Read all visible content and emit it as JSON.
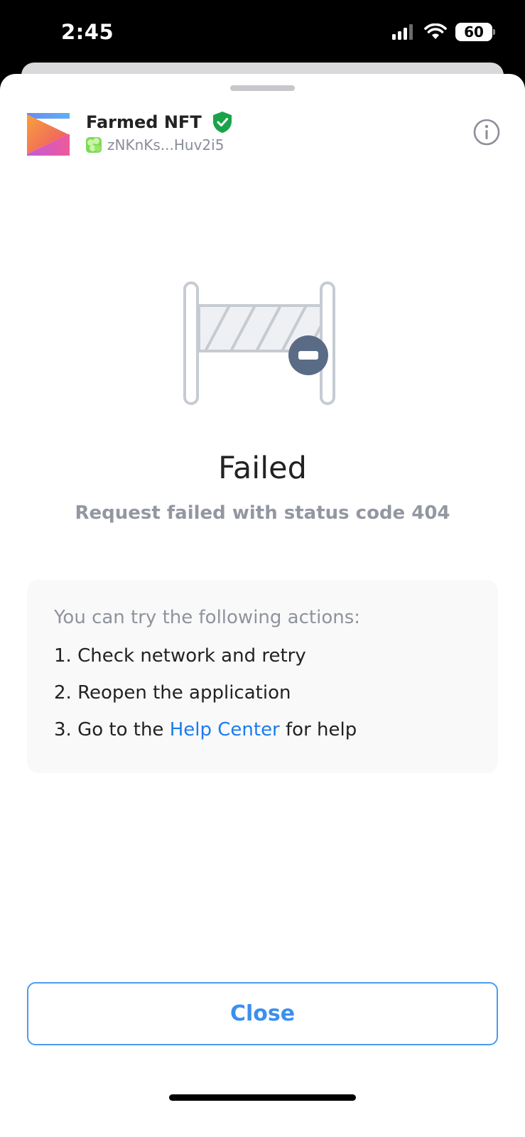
{
  "status_bar": {
    "time": "2:45",
    "battery": "60"
  },
  "dapp": {
    "name": "Farmed NFT",
    "address": "zNKnKs...Huv2i5"
  },
  "result": {
    "title": "Failed",
    "message": "Request failed with status code 404"
  },
  "suggestions": {
    "heading": "You can try the following actions:",
    "item1": "1. Check network and retry",
    "item2": "2. Reopen the application",
    "item3_prefix": "3. Go to the ",
    "item3_link": "Help Center",
    "item3_suffix": " for help"
  },
  "buttons": {
    "close": "Close"
  },
  "colors": {
    "accent": "#1a7cf0",
    "verified": "#1aa34a"
  }
}
